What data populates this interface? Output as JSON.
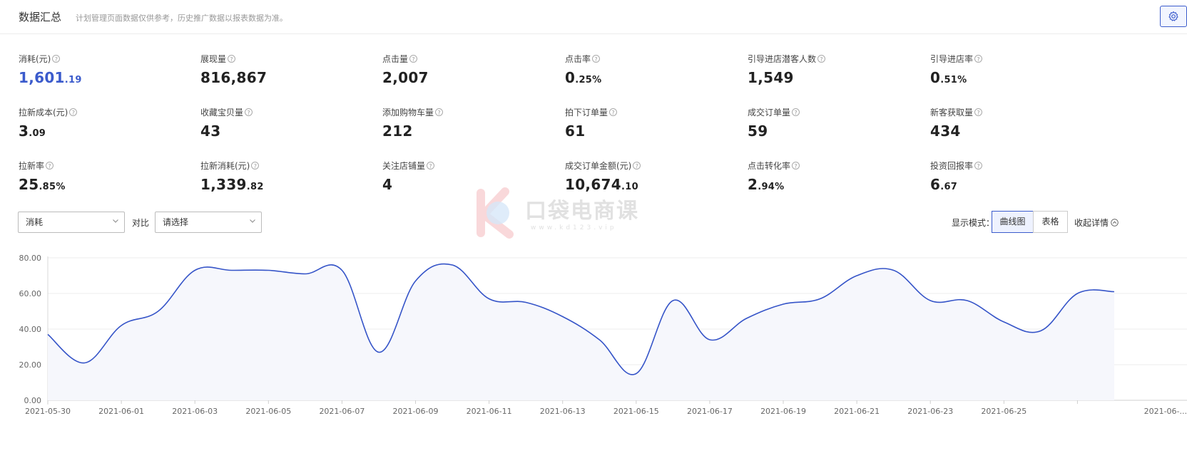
{
  "header": {
    "title": "数据汇总",
    "notice": "计划管理页面数据仅供参考，历史推广数据以报表数据为准。"
  },
  "metrics": [
    {
      "label": "消耗(元)",
      "int": "1,601",
      "dec": ".19",
      "highlight": true
    },
    {
      "label": "展现量",
      "int": "816,867",
      "dec": ""
    },
    {
      "label": "点击量",
      "int": "2,007",
      "dec": ""
    },
    {
      "label": "点击率",
      "int": "0",
      "dec": ".25%"
    },
    {
      "label": "引导进店潜客人数",
      "int": "1,549",
      "dec": ""
    },
    {
      "label": "引导进店率",
      "int": "0",
      "dec": ".51%"
    },
    {
      "label": "拉新成本(元)",
      "int": "3",
      "dec": ".09"
    },
    {
      "label": "收藏宝贝量",
      "int": "43",
      "dec": ""
    },
    {
      "label": "添加购物车量",
      "int": "212",
      "dec": ""
    },
    {
      "label": "拍下订单量",
      "int": "61",
      "dec": ""
    },
    {
      "label": "成交订单量",
      "int": "59",
      "dec": ""
    },
    {
      "label": "新客获取量",
      "int": "434",
      "dec": ""
    },
    {
      "label": "拉新率",
      "int": "25",
      "dec": ".85%"
    },
    {
      "label": "拉新消耗(元)",
      "int": "1,339",
      "dec": ".82"
    },
    {
      "label": "关注店铺量",
      "int": "4",
      "dec": ""
    },
    {
      "label": "成交订单金额(元)",
      "int": "10,674",
      "dec": ".10"
    },
    {
      "label": "点击转化率",
      "int": "2",
      "dec": ".94%"
    },
    {
      "label": "投资回报率",
      "int": "6",
      "dec": ".67"
    }
  ],
  "controls": {
    "metric_select": "消耗",
    "compare_label": "对比",
    "compare_select": "请选择",
    "mode_label": "显示模式：",
    "mode_curve": "曲线图",
    "mode_table": "表格",
    "collapse_label": "收起详情"
  },
  "watermark": {
    "text": "口袋电商课",
    "url": "www.kd123.vip"
  },
  "colors": {
    "accent": "#3b5bcc",
    "line": "#3554c8",
    "area": "#f6f7fc"
  },
  "chart_data": {
    "type": "area",
    "x": [
      "2021-05-30",
      "2021-05-31",
      "2021-06-01",
      "2021-06-02",
      "2021-06-03",
      "2021-06-04",
      "2021-06-05",
      "2021-06-06",
      "2021-06-07",
      "2021-06-08",
      "2021-06-09",
      "2021-06-10",
      "2021-06-11",
      "2021-06-12",
      "2021-06-13",
      "2021-06-14",
      "2021-06-15",
      "2021-06-16",
      "2021-06-17",
      "2021-06-18",
      "2021-06-19",
      "2021-06-20",
      "2021-06-21",
      "2021-06-22",
      "2021-06-23",
      "2021-06-24",
      "2021-06-25",
      "2021-06-26",
      "2021-06-27",
      "2021-06-28"
    ],
    "tick_labels": [
      "2021-05-30",
      "2021-06-01",
      "2021-06-03",
      "2021-06-05",
      "2021-06-07",
      "2021-06-09",
      "2021-06-11",
      "2021-06-13",
      "2021-06-15",
      "2021-06-17",
      "2021-06-19",
      "2021-06-21",
      "2021-06-23",
      "2021-06-25",
      "2021-06-..."
    ],
    "series": [
      {
        "values": [
          37,
          21,
          42,
          50,
          73,
          73,
          73,
          71,
          73,
          27,
          67,
          76,
          57,
          55,
          47,
          34,
          15,
          56,
          34,
          46,
          54,
          57,
          70,
          73,
          56,
          56,
          44,
          39,
          60,
          61
        ]
      }
    ],
    "ylim": [
      0,
      80
    ],
    "yticks": [
      "0.00",
      "20.00",
      "40.00",
      "60.00",
      "80.00"
    ],
    "grid": true,
    "xlabel": "",
    "ylabel": ""
  }
}
